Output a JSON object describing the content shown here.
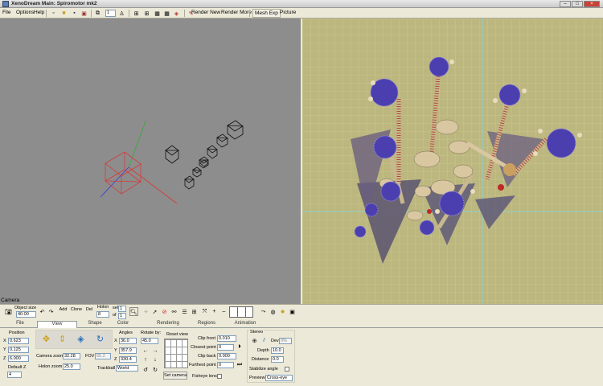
{
  "window": {
    "title": "XenoDream Main: Spiromotor mk2"
  },
  "menu": {
    "items": [
      "File",
      "Options",
      "Help"
    ]
  },
  "toolbar": {
    "undo_selector": "1",
    "render_new": "Render New",
    "render_more": "Render More",
    "mesh_exp": "Mesh Exp",
    "picture": "Picture"
  },
  "viewport": {
    "label": "Camera"
  },
  "toolbar2": {
    "object_size_label": "Object size",
    "object_size_value": "40.00",
    "add": "Add",
    "clone": "Clone",
    "del": "Del",
    "holon_label": "Holon",
    "holon_value": "8",
    "sel_label": "sel",
    "sel_value": "1",
    "of_label": "of",
    "of_value": "1"
  },
  "tabs": [
    "File",
    "View",
    "Shape",
    "Color",
    "Rendering",
    "Regions",
    "Animation"
  ],
  "active_tab": "View",
  "view": {
    "position_label": "Position",
    "x_label": "X",
    "x_value": "0.623",
    "y_label": "Y",
    "y_value": "0.125",
    "z_label": "Z",
    "z_value": "6.000",
    "default_z_label": "Default Z",
    "default_z_value": "4",
    "camera_zoom_label": "Camera zoom",
    "camera_zoom_value": "32.28",
    "fov_label": "FOV",
    "fov_value": "65.2",
    "holon_zoom_label": "Holon zoom",
    "holon_zoom_value": "25.0",
    "angles_label": "Angles",
    "ax_label": "X",
    "ax_value": "36.0",
    "ay_label": "Y",
    "ay_value": "357.9",
    "az_label": "Z",
    "az_value": "330.4",
    "rotate_by_label": "Rotate by:",
    "rotate_by_value": "45.0",
    "trackball_label": "Trackball",
    "trackball_value": "World",
    "reset_view": "Reset view",
    "set_camera": "Set camera",
    "clip_front_label": "Clip front",
    "clip_front_value": "0.010",
    "closest_point_label": "Closest point",
    "closest_point_value": "0",
    "clip_back_label": "Clip back",
    "clip_back_value": "0.000",
    "furthest_point_label": "Furthest point",
    "furthest_point_value": "0",
    "fisheye_lens_label": "Fisheye lens",
    "stereo_label": "Stereo",
    "dev_label": "Dev",
    "dev_value": "0%",
    "depth_label": "Depth",
    "depth_value": "10.0",
    "distance_label": "Distance",
    "distance_value": "0.0",
    "stabilize_angle_label": "Stabilize angle",
    "preview_label": "Preview",
    "preview_value": "Cross-eye"
  },
  "colors": {
    "viewport_left_bg": "#8d8d8d",
    "viewport_right_bg": "#bcb77f",
    "grid_line": "#d8d49b",
    "axis_cyan": "#7fd4e8",
    "camera_red": "#d63a3a",
    "axis_green": "#3aa83a",
    "axis_blue": "#3a3ad6",
    "fractal_purple": "#4b3fb0",
    "fractal_tan": "#d8c7a0"
  }
}
